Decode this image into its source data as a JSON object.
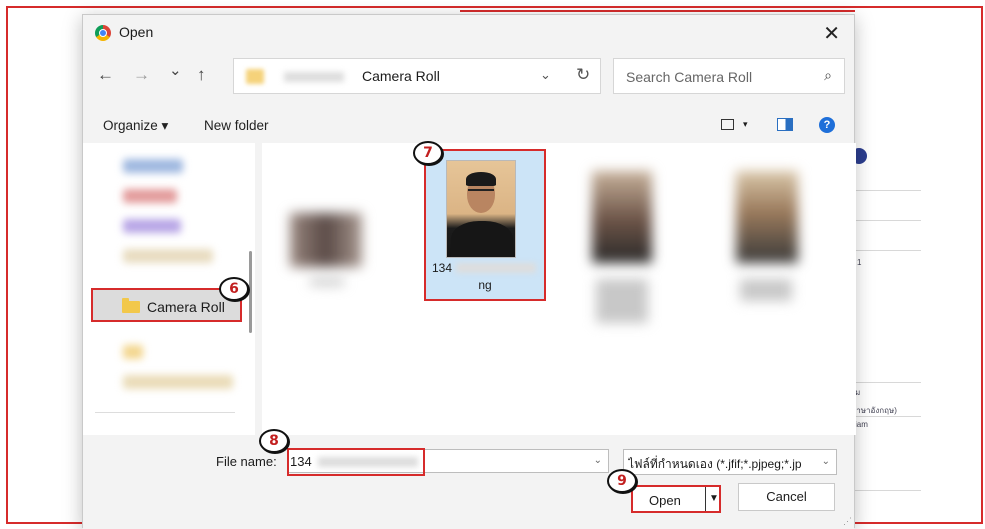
{
  "dialog": {
    "title": "Open",
    "close_label": "✕"
  },
  "nav": {
    "back": "←",
    "forward": "→",
    "recent": "⌄",
    "up": "↑",
    "address": "Camera Roll",
    "address_chevron": "⌄",
    "refresh": "↻",
    "search_placeholder": "Search Camera Roll",
    "search_icon": "⌕"
  },
  "toolbar": {
    "organize": "Organize ▾",
    "new_folder": "New folder",
    "view_caret": "▾",
    "help": "?"
  },
  "sidebar": {
    "selected_item": "Camera Roll"
  },
  "content": {
    "selected_file": {
      "name_line1": "134",
      "name_line2": "ng"
    }
  },
  "bottom": {
    "file_name_label": "File name:",
    "file_name_value": "134",
    "file_type_filter": "ไฟล์ที่กำหนดเอง (*.jfif;*.pjpeg;*.jp",
    "dropdown_arrow": "⌄",
    "open_label": "Open",
    "open_caret": "▼",
    "cancel_label": "Cancel"
  },
  "badges": {
    "b6": "6",
    "b7": "7",
    "b8": "8",
    "b9": "9"
  },
  "background_page": {
    "text1": "ม",
    "text2": "ภาษาอังกฤษ)",
    "text3": "siam",
    "text4": "1"
  },
  "colors": {
    "highlight_red": "#d62b2b",
    "selection_blue": "#cce4f7",
    "help_blue": "#1e6fd9"
  },
  "icons": {
    "app": "chrome-icon",
    "folder": "folder-icon",
    "help": "help-icon"
  }
}
